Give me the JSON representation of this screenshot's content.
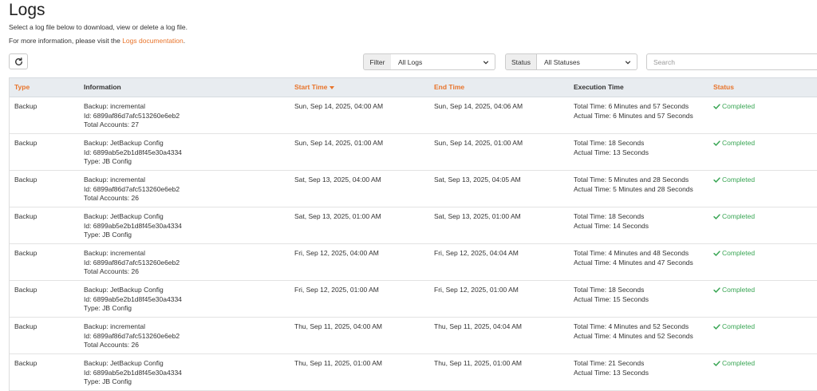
{
  "page": {
    "title": "Logs",
    "description": "Select a log file below to download, view or delete a log file.",
    "more_info_prefix": "For more information, please visit the ",
    "more_info_link": "Logs documentation",
    "more_info_suffix": "."
  },
  "toolbar": {
    "filter_label": "Filter",
    "filter_value": "All Logs",
    "status_label": "Status",
    "status_value": "All Statuses",
    "search_placeholder": "Search"
  },
  "table": {
    "columns": {
      "type": "Type",
      "information": "Information",
      "start_time": "Start Time",
      "end_time": "End Time",
      "execution_time": "Execution Time",
      "status": "Status"
    },
    "rows": [
      {
        "type": "Backup",
        "info1": "Backup: incremental",
        "info2": "Id: 6899af86d7afc513260e6eb2",
        "info3": "Total Accounts: 27",
        "start": "Sun, Sep 14, 2025, 04:00 AM",
        "end": "Sun, Sep 14, 2025, 04:06 AM",
        "exec1": "Total Time: 6 Minutes and 57 Seconds",
        "exec2": "Actual Time: 6 Minutes and 57 Seconds",
        "status": "Completed"
      },
      {
        "type": "Backup",
        "info1": "Backup: JetBackup Config",
        "info2": "Id: 6899ab5e2b1d8f45e30a4334",
        "info3": "Type: JB Config",
        "start": "Sun, Sep 14, 2025, 01:00 AM",
        "end": "Sun, Sep 14, 2025, 01:00 AM",
        "exec1": "Total Time: 18 Seconds",
        "exec2": "Actual Time: 13 Seconds",
        "status": "Completed"
      },
      {
        "type": "Backup",
        "info1": "Backup: incremental",
        "info2": "Id: 6899af86d7afc513260e6eb2",
        "info3": "Total Accounts: 26",
        "start": "Sat, Sep 13, 2025, 04:00 AM",
        "end": "Sat, Sep 13, 2025, 04:05 AM",
        "exec1": "Total Time: 5 Minutes and 28 Seconds",
        "exec2": "Actual Time: 5 Minutes and 28 Seconds",
        "status": "Completed"
      },
      {
        "type": "Backup",
        "info1": "Backup: JetBackup Config",
        "info2": "Id: 6899ab5e2b1d8f45e30a4334",
        "info3": "Type: JB Config",
        "start": "Sat, Sep 13, 2025, 01:00 AM",
        "end": "Sat, Sep 13, 2025, 01:00 AM",
        "exec1": "Total Time: 18 Seconds",
        "exec2": "Actual Time: 14 Seconds",
        "status": "Completed"
      },
      {
        "type": "Backup",
        "info1": "Backup: incremental",
        "info2": "Id: 6899af86d7afc513260e6eb2",
        "info3": "Total Accounts: 26",
        "start": "Fri, Sep 12, 2025, 04:00 AM",
        "end": "Fri, Sep 12, 2025, 04:04 AM",
        "exec1": "Total Time: 4 Minutes and 48 Seconds",
        "exec2": "Actual Time: 4 Minutes and 47 Seconds",
        "status": "Completed"
      },
      {
        "type": "Backup",
        "info1": "Backup: JetBackup Config",
        "info2": "Id: 6899ab5e2b1d8f45e30a4334",
        "info3": "Type: JB Config",
        "start": "Fri, Sep 12, 2025, 01:00 AM",
        "end": "Fri, Sep 12, 2025, 01:00 AM",
        "exec1": "Total Time: 18 Seconds",
        "exec2": "Actual Time: 15 Seconds",
        "status": "Completed"
      },
      {
        "type": "Backup",
        "info1": "Backup: incremental",
        "info2": "Id: 6899af86d7afc513260e6eb2",
        "info3": "Total Accounts: 26",
        "start": "Thu, Sep 11, 2025, 04:00 AM",
        "end": "Thu, Sep 11, 2025, 04:04 AM",
        "exec1": "Total Time: 4 Minutes and 52 Seconds",
        "exec2": "Actual Time: 4 Minutes and 52 Seconds",
        "status": "Completed"
      },
      {
        "type": "Backup",
        "info1": "Backup: JetBackup Config",
        "info2": "Id: 6899ab5e2b1d8f45e30a4334",
        "info3": "Type: JB Config",
        "start": "Thu, Sep 11, 2025, 01:00 AM",
        "end": "Thu, Sep 11, 2025, 01:00 AM",
        "exec1": "Total Time: 21 Seconds",
        "exec2": "Actual Time: 13 Seconds",
        "status": "Completed"
      }
    ]
  },
  "colors": {
    "accent": "#e8742b",
    "success": "#3aa655",
    "header_bg": "#e8ecf0"
  },
  "icons": {
    "refresh": "refresh-icon",
    "sort": "sort-desc-icon",
    "status": "check-icon",
    "select": "chevron-down-icon"
  }
}
